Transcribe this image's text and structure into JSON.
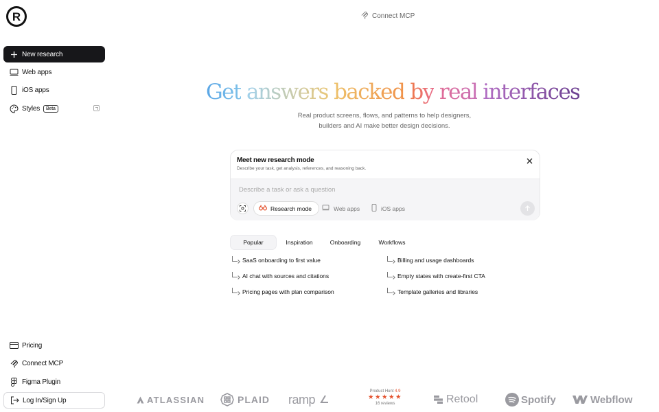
{
  "brand": {
    "logo_letter": "R"
  },
  "sidebar": {
    "new_research": "New research",
    "items": [
      {
        "label": "Web apps",
        "icon": "monitor-icon"
      },
      {
        "label": "iOS apps",
        "icon": "phone-icon"
      },
      {
        "label": "Styles",
        "icon": "palette-icon",
        "badge": "Beta"
      }
    ],
    "bottom": [
      {
        "label": "Pricing",
        "icon": "credit-card-icon"
      },
      {
        "label": "Connect MCP",
        "icon": "mcp-icon"
      },
      {
        "label": "Figma Plugin",
        "icon": "figma-icon"
      }
    ],
    "login": "Log In/Sign Up"
  },
  "top": {
    "connect_mcp": "Connect MCP"
  },
  "hero": {
    "title_words": [
      "Get",
      "answers",
      "backed",
      "by",
      "real",
      "interfaces"
    ],
    "subtitle_line1": "Real product screens, flows, and patterns to help designers,",
    "subtitle_line2": "builders and AI make better design decisions."
  },
  "research_card": {
    "title": "Meet new research mode",
    "description": "Describe your task, get analysis, references, and reasoning back.",
    "placeholder": "Describe a task or ask a question",
    "mode_label": "Research mode",
    "chips": [
      "Web apps",
      "iOS apps"
    ]
  },
  "tabs": [
    "Popular",
    "Inspiration",
    "Onboarding",
    "Workflows"
  ],
  "active_tab": "Popular",
  "suggestions": [
    "SaaS onboarding to first value",
    "Billing and usage dashboards",
    "AI chat with sources and citations",
    "Empty states with create-first CTA",
    "Pricing pages with plan comparison",
    "Template galleries and libraries"
  ],
  "logos": {
    "atlassian": "ATLASSIAN",
    "plaid": "PLAID",
    "ramp": "ramp",
    "retool": "Retool",
    "spotify": "Spotify",
    "webflow": "Webflow",
    "product_hunt": {
      "label": "Product Hunt",
      "score": "4.9",
      "stars": "★★★★★",
      "reviews": "16 reviews"
    }
  },
  "colors": {
    "primary_dark": "#17171a",
    "accent_red": "#e4532f",
    "muted_text": "#666666"
  }
}
